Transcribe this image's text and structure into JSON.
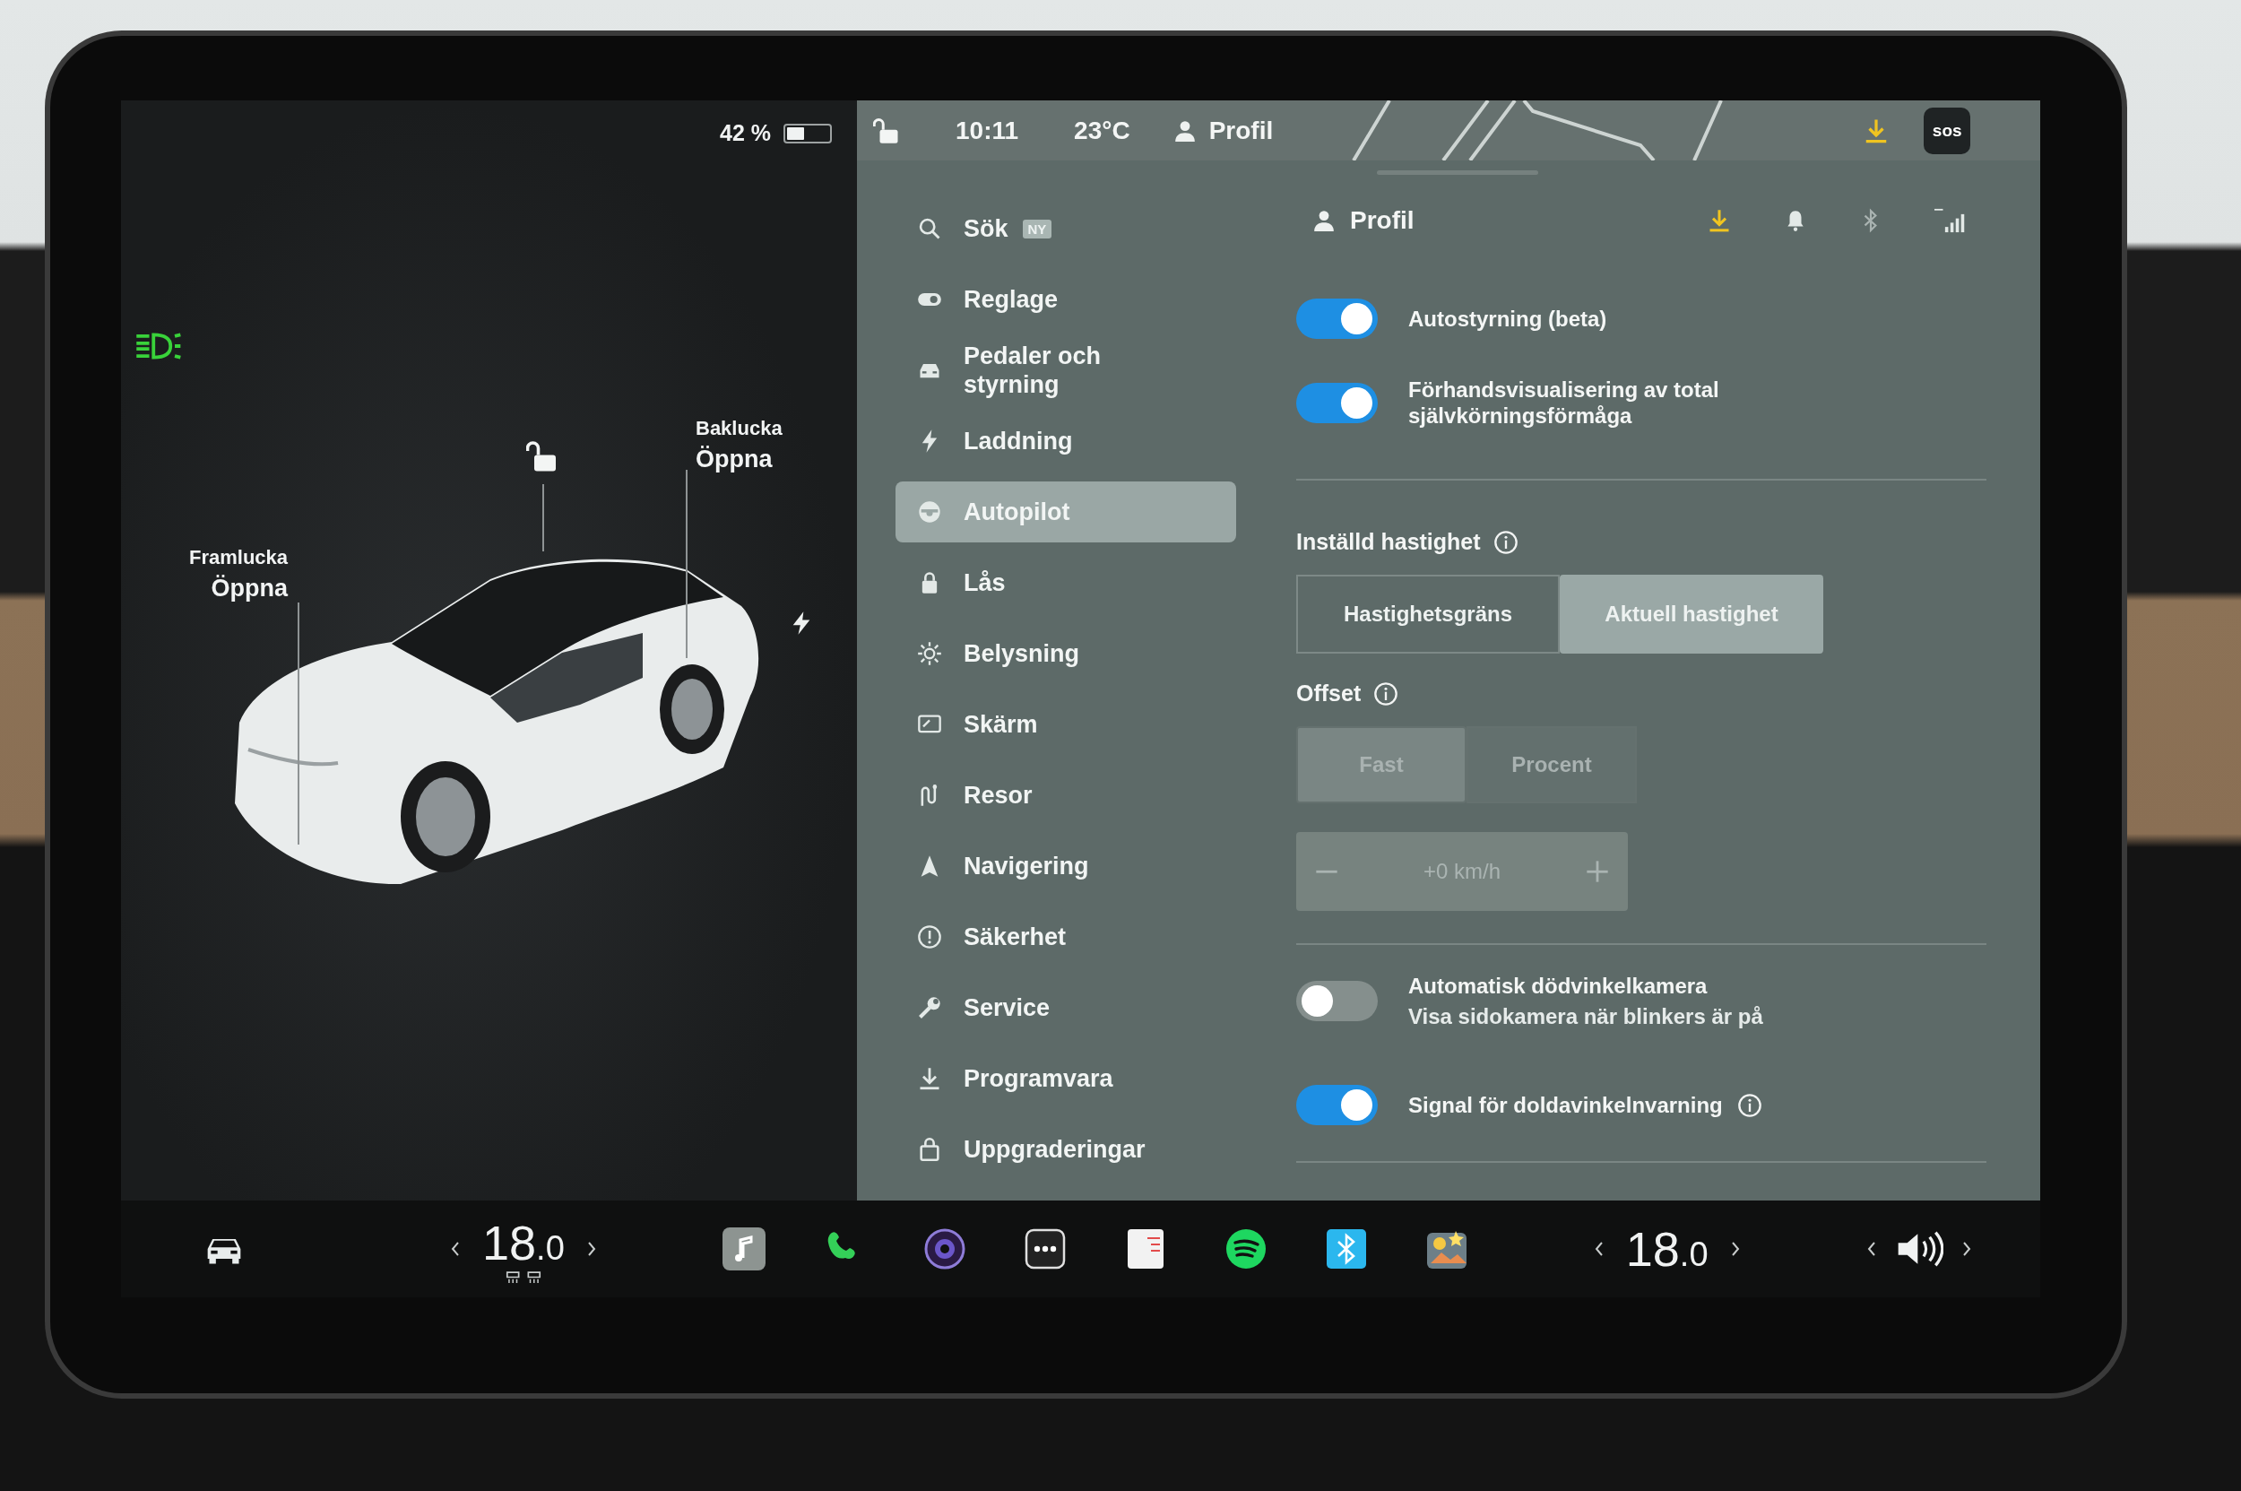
{
  "left_panel": {
    "battery": {
      "reading": "42 %",
      "level": 0.42
    },
    "callouts": [
      {
        "title": "Framlucka",
        "action": "Öppna"
      },
      {
        "title": "Baklucka",
        "action": "Öppna"
      }
    ]
  },
  "top_bar": {
    "time": "10:11",
    "temperature": "23°C",
    "profile": "Profil",
    "sos": "sos"
  },
  "sidebar": {
    "items": [
      {
        "label": "Sök",
        "badge": "NY",
        "selected": false
      },
      {
        "label": "Reglage",
        "selected": false
      },
      {
        "label": "Pedaler och styrning",
        "selected": false
      },
      {
        "label": "Laddning",
        "selected": false
      },
      {
        "label": "Autopilot",
        "selected": true
      },
      {
        "label": "Lås",
        "selected": false
      },
      {
        "label": "Belysning",
        "selected": false
      },
      {
        "label": "Skärm",
        "selected": false
      },
      {
        "label": "Resor",
        "selected": false
      },
      {
        "label": "Navigering",
        "selected": false
      },
      {
        "label": "Säkerhet",
        "selected": false
      },
      {
        "label": "Service",
        "selected": false
      },
      {
        "label": "Programvara",
        "selected": false
      },
      {
        "label": "Uppgraderingar",
        "selected": false
      }
    ]
  },
  "content": {
    "title": "Profil",
    "toggles": [
      {
        "label": "Autostyrning (beta)",
        "on": true
      },
      {
        "label": "Förhandsvisualisering av total självkörningsförmåga",
        "on": true
      }
    ],
    "set_speed": {
      "label": "Inställd hastighet",
      "options": [
        {
          "label": "Hastighetsgräns",
          "selected": false
        },
        {
          "label": "Aktuell hastighet",
          "selected": true
        }
      ]
    },
    "offset": {
      "label": "Offset",
      "disabled": true,
      "options": [
        {
          "label": "Fast",
          "selected": true
        },
        {
          "label": "Procent",
          "selected": false
        }
      ]
    },
    "offset_stepper": {
      "value": "+0 km/h",
      "disabled": true
    },
    "camera_toggles": [
      {
        "label": "Automatisk dödvinkelkamera",
        "description": "Visa sidokamera när blinkers är på",
        "on": false
      },
      {
        "label": "Signal för doldavinkelnvarning",
        "on": true,
        "info": true
      }
    ]
  },
  "dock": {
    "climate": [
      {
        "whole": "18",
        "decimal": ".0"
      },
      {
        "whole": "18",
        "decimal": ".0"
      }
    ]
  }
}
